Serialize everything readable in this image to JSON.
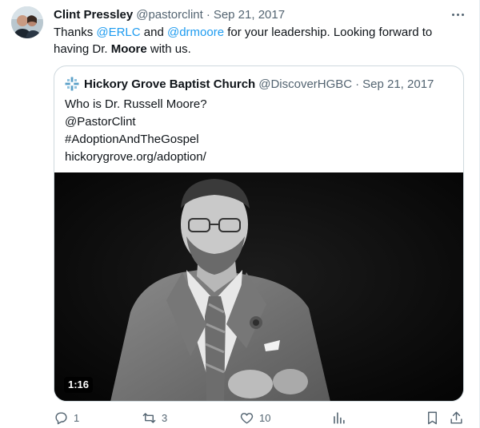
{
  "tweet": {
    "author_name": "Clint Pressley",
    "author_handle": "@pastorclint",
    "separator": "·",
    "date": "Sep 21, 2017",
    "text_segments": {
      "t1": "Thanks ",
      "m1": "@ERLC",
      "t2": " and ",
      "m2": "@drmoore",
      "t3": " for your leadership. Looking forward to having Dr. ",
      "b1": "Moore",
      "t4": " with us."
    }
  },
  "quoted": {
    "author_name": "Hickory Grove Baptist Church",
    "author_handle": "@DiscoverHGBC",
    "separator": "·",
    "date": "Sep 21, 2017",
    "lines": [
      "Who is Dr. Russell Moore?",
      "@PastorClint",
      "#AdoptionAndTheGospel",
      "hickorygrove.org/adoption/"
    ],
    "video_duration": "1:16"
  },
  "actions": {
    "reply_count": "1",
    "retweet_count": "3",
    "like_count": "10"
  },
  "colors": {
    "link": "#1d9bf0",
    "secondary_text": "#536471",
    "border": "#cfd9de",
    "logo": "#5aa0c8"
  },
  "icons": {
    "more": "more-icon",
    "reply": "reply-icon",
    "retweet": "retweet-icon",
    "like": "heart-icon",
    "views": "analytics-icon",
    "bookmark": "bookmark-icon",
    "share": "share-icon",
    "church_logo": "church-cross-logo"
  }
}
